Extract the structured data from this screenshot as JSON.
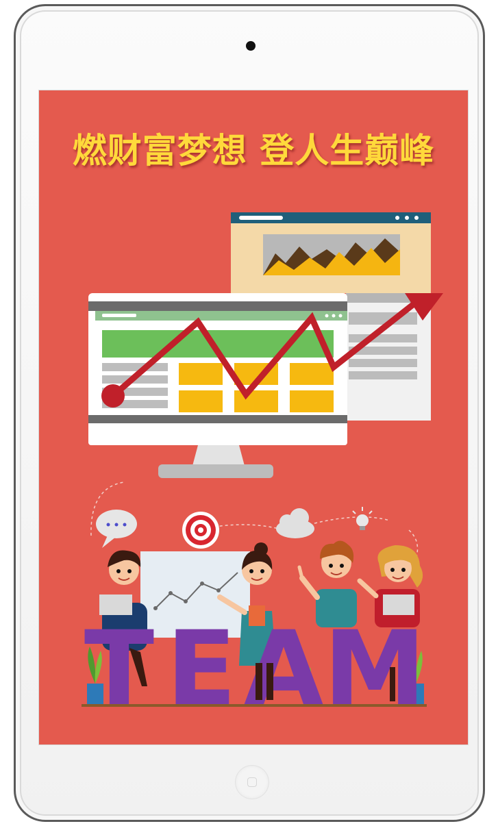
{
  "poster": {
    "headline": "燃财富梦想  登人生巅峰",
    "team_word": [
      "T",
      "E",
      "A",
      "M"
    ]
  },
  "colors": {
    "background": "#e45a4e",
    "headline": "#ffd93b",
    "team_letters": "#7a3aa8",
    "trend_arrow": "#c0202a"
  },
  "icons": [
    "camera-icon",
    "chat-bubble-icon",
    "target-icon",
    "cloud-icon",
    "lightbulb-icon",
    "home-button-icon"
  ]
}
